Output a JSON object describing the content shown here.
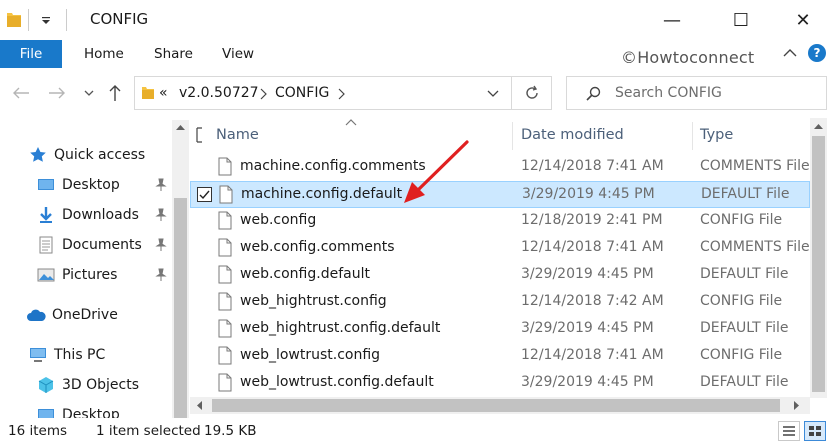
{
  "window": {
    "title": "CONFIG",
    "minimize_glyph": "—",
    "maximize_glyph": "☐",
    "close_glyph": "✕"
  },
  "ribbon": {
    "tabs": [
      "File",
      "Home",
      "Share",
      "View"
    ],
    "watermark": "©Howtoconnect",
    "help_glyph": "?"
  },
  "address": {
    "overflow": "«",
    "segments": [
      "v2.0.50727",
      "CONFIG"
    ],
    "search_placeholder": "Search CONFIG"
  },
  "nav_pane": {
    "items": [
      {
        "label": "Quick access",
        "icon": "star-icon"
      },
      {
        "label": "Desktop",
        "icon": "desktop-icon",
        "pinned": true
      },
      {
        "label": "Downloads",
        "icon": "download-icon",
        "pinned": true
      },
      {
        "label": "Documents",
        "icon": "documents-icon",
        "pinned": true
      },
      {
        "label": "Pictures",
        "icon": "pictures-icon",
        "pinned": true
      },
      {
        "label": "OneDrive",
        "icon": "cloud-icon"
      },
      {
        "label": "This PC",
        "icon": "computer-icon"
      },
      {
        "label": "3D Objects",
        "icon": "cube-icon"
      },
      {
        "label": "Desktop",
        "icon": "desktop-icon"
      }
    ]
  },
  "file_list": {
    "columns": [
      "Name",
      "Date modified",
      "Type"
    ],
    "rows": [
      {
        "name": "machine.config.comments",
        "date": "12/14/2018 7:41 AM",
        "type": "COMMENTS File",
        "selected": false
      },
      {
        "name": "machine.config.default",
        "date": "3/29/2019 4:45 PM",
        "type": "DEFAULT File",
        "selected": true
      },
      {
        "name": "web.config",
        "date": "12/18/2019 2:41 PM",
        "type": "CONFIG File",
        "selected": false
      },
      {
        "name": "web.config.comments",
        "date": "12/14/2018 7:41 AM",
        "type": "COMMENTS File",
        "selected": false
      },
      {
        "name": "web.config.default",
        "date": "3/29/2019 4:45 PM",
        "type": "DEFAULT File",
        "selected": false
      },
      {
        "name": "web_hightrust.config",
        "date": "12/14/2018 7:42 AM",
        "type": "CONFIG File",
        "selected": false
      },
      {
        "name": "web_hightrust.config.default",
        "date": "3/29/2019 4:45 PM",
        "type": "DEFAULT File",
        "selected": false
      },
      {
        "name": "web_lowtrust.config",
        "date": "12/14/2018 7:41 AM",
        "type": "CONFIG File",
        "selected": false
      },
      {
        "name": "web_lowtrust.config.default",
        "date": "3/29/2019 4:45 PM",
        "type": "DEFAULT File",
        "selected": false
      }
    ]
  },
  "status": {
    "item_count": "16 items",
    "selection": "1 item selected",
    "size": "19.5 KB"
  },
  "colors": {
    "accent": "#1979ca",
    "selection_bg": "#cce8ff",
    "annotation_arrow": "#e02020"
  }
}
